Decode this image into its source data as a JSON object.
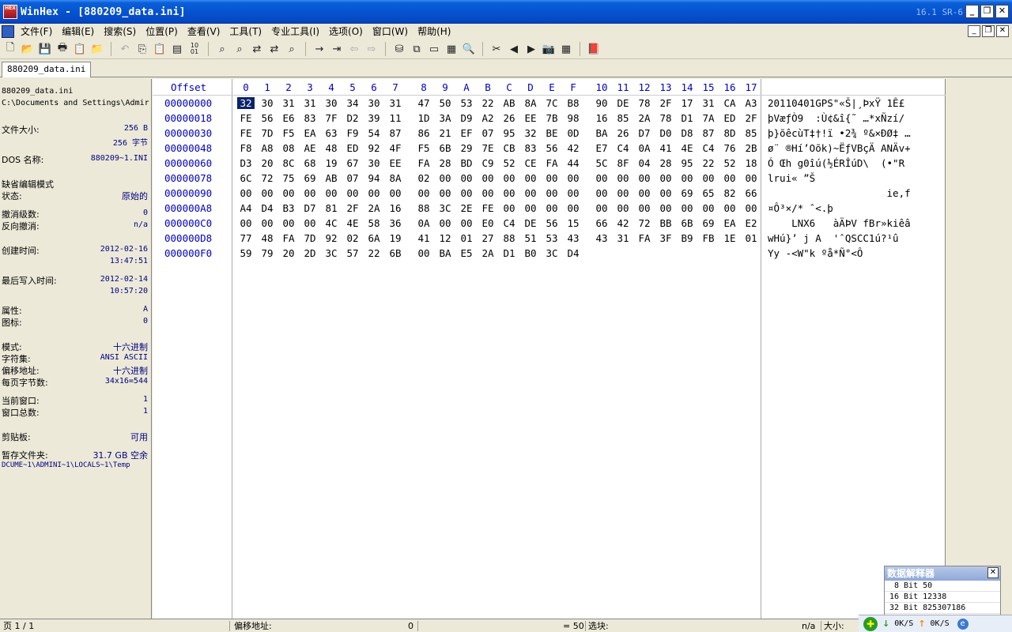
{
  "window": {
    "title": "WinHex - [880209_data.ini]",
    "version": "16.1 SR-6",
    "app_icon": "HEX",
    "controls": [
      "_",
      "❐",
      "✕"
    ]
  },
  "menu": {
    "items": [
      "文件(F)",
      "编辑(E)",
      "搜索(S)",
      "位置(P)",
      "查看(V)",
      "工具(T)",
      "专业工具(I)",
      "选项(O)",
      "窗口(W)",
      "帮助(H)"
    ]
  },
  "toolbar": {
    "icons": [
      "new-file-icon",
      "open-icon",
      "save-icon",
      "print-icon",
      "properties-icon",
      "open-disk-icon",
      "undo-icon",
      "copy-icon",
      "paste-icon",
      "paste-special-icon",
      "binary-icon",
      "find-text-icon",
      "find-hex-icon",
      "replace-text-icon",
      "replace-hex-icon",
      "find-next-icon",
      "goto-offset-icon",
      "goto-icon",
      "back-icon",
      "forward-icon",
      "disk-icon",
      "clone-icon",
      "ram-icon",
      "calculator-icon",
      "search-icon",
      "cut-icon",
      "prev-icon",
      "next-icon",
      "snapshot-icon",
      "table-icon",
      "help-book-icon"
    ]
  },
  "tab": {
    "label": "880209_data.ini"
  },
  "info_panel": {
    "file_name": "880209_data.ini",
    "file_path": "C:\\Documents and Settings\\Admir",
    "file_size_label": "文件大小:",
    "file_size_b": "256 B",
    "file_size_bytes": "256 字节",
    "dos_name_label": "DOS 名称:",
    "dos_name": "880209~1.INI",
    "edit_mode_label": "缺省编辑模式",
    "status_label": "状态:",
    "status": "原始的",
    "undo_levels_label": "撤消级数:",
    "undo_levels": "0",
    "reverse_undo_label": "反向撤消:",
    "reverse_undo": "n/a",
    "created_label": "创建时间:",
    "created_date": "2012-02-16",
    "created_time": "13:47:51",
    "modified_label": "最后写入时间:",
    "modified_date": "2012-02-14",
    "modified_time": "10:57:20",
    "attr_label": "属性:",
    "attr": "A",
    "icon_label": "图标:",
    "icon": "0",
    "mode_label": "模式:",
    "mode": "十六进制",
    "charset_label": "字符集:",
    "charset": "ANSI ASCII",
    "offset_label": "偏移地址:",
    "offset": "十六进制",
    "bytes_per_page_label": "每页字节数:",
    "bytes_per_page": "34x16=544",
    "current_window_label": "当前窗口:",
    "current_window": "1",
    "total_windows_label": "窗口总数:",
    "total_windows": "1",
    "clipboard_label": "剪贴板:",
    "clipboard": "可用",
    "temp_folder_label": "暂存文件夹:",
    "temp_folder_space": "31.7 GB 空余",
    "temp_folder_path": "DCUME~1\\ADMINI~1\\LOCALS~1\\Temp"
  },
  "hex_view": {
    "offset_header": "Offset",
    "columns": [
      "0",
      "1",
      "2",
      "3",
      "4",
      "5",
      "6",
      "7",
      "8",
      "9",
      "A",
      "B",
      "C",
      "D",
      "E",
      "F",
      "10",
      "11",
      "12",
      "13",
      "14",
      "15",
      "16",
      "17"
    ],
    "rows": [
      {
        "offset": "00000000",
        "bytes": [
          "32",
          "30",
          "31",
          "31",
          "30",
          "34",
          "30",
          "31",
          "47",
          "50",
          "53",
          "22",
          "AB",
          "8A",
          "7C",
          "B8",
          "90",
          "DE",
          "78",
          "2F",
          "17",
          "31",
          "CA",
          "A3"
        ],
        "ascii": "20110401GPS\"«Š|¸ÞxŸ 1Ê£"
      },
      {
        "offset": "00000018",
        "bytes": [
          "FE",
          "56",
          "E6",
          "83",
          "7F",
          "D2",
          "39",
          "11",
          "1D",
          "3A",
          "D9",
          "A2",
          "26",
          "EE",
          "7B",
          "98",
          "16",
          "85",
          "2A",
          "78",
          "D1",
          "7A",
          "ED",
          "2F"
        ],
        "ascii": "þVæƒÒ9  :Ù¢&î{˜ …*xÑzí/"
      },
      {
        "offset": "00000030",
        "bytes": [
          "FE",
          "7D",
          "F5",
          "EA",
          "63",
          "F9",
          "54",
          "87",
          "86",
          "21",
          "EF",
          "07",
          "95",
          "32",
          "BE",
          "0D",
          "BA",
          "26",
          "D7",
          "D0",
          "D8",
          "87",
          "8D",
          "85"
        ],
        "ascii": "þ}õêcùT‡†!ï •2¾ º&×ÐØ‡ …"
      },
      {
        "offset": "00000048",
        "bytes": [
          "F8",
          "A8",
          "08",
          "AE",
          "48",
          "ED",
          "92",
          "4F",
          "F5",
          "6B",
          "29",
          "7E",
          "CB",
          "83",
          "56",
          "42",
          "E7",
          "C4",
          "0A",
          "41",
          "4E",
          "C4",
          "76",
          "2B"
        ],
        "ascii": "ø¨ ®Hí’Oõk)~ËƒVBçÄ ANÄv+"
      },
      {
        "offset": "00000060",
        "bytes": [
          "D3",
          "20",
          "8C",
          "68",
          "19",
          "67",
          "30",
          "EE",
          "FA",
          "28",
          "BD",
          "C9",
          "52",
          "CE",
          "FA",
          "44",
          "5C",
          "8F",
          "04",
          "28",
          "95",
          "22",
          "52",
          "18"
        ],
        "ascii": "Ó Œh g0îú(½ÉRÎúD\\  (•\"R "
      },
      {
        "offset": "00000078",
        "bytes": [
          "6C",
          "72",
          "75",
          "69",
          "AB",
          "07",
          "94",
          "8A",
          "02",
          "00",
          "00",
          "00",
          "00",
          "00",
          "00",
          "00",
          "00",
          "00",
          "00",
          "00",
          "00",
          "00",
          "00",
          "00"
        ],
        "ascii": "lrui« ”Š"
      },
      {
        "offset": "00000090",
        "bytes": [
          "00",
          "00",
          "00",
          "00",
          "00",
          "00",
          "00",
          "00",
          "00",
          "00",
          "00",
          "00",
          "00",
          "00",
          "00",
          "00",
          "00",
          "00",
          "00",
          "00",
          "69",
          "65",
          "82",
          "66"
        ],
        "ascii": "                    ie‚f"
      },
      {
        "offset": "000000A8",
        "bytes": [
          "A4",
          "D4",
          "B3",
          "D7",
          "81",
          "2F",
          "2A",
          "16",
          "88",
          "3C",
          "2E",
          "FE",
          "00",
          "00",
          "00",
          "00",
          "00",
          "00",
          "00",
          "00",
          "00",
          "00",
          "00",
          "00"
        ],
        "ascii": "¤Ô³×/* ˆ<.þ"
      },
      {
        "offset": "000000C0",
        "bytes": [
          "00",
          "00",
          "00",
          "00",
          "4C",
          "4E",
          "58",
          "36",
          "0A",
          "00",
          "00",
          "E0",
          "C4",
          "DE",
          "56",
          "15",
          "66",
          "42",
          "72",
          "BB",
          "6B",
          "69",
          "EA",
          "E2"
        ],
        "ascii": "    LNX6   àÄÞV fBr»kiêâ"
      },
      {
        "offset": "000000D8",
        "bytes": [
          "77",
          "48",
          "FA",
          "7D",
          "92",
          "02",
          "6A",
          "19",
          "41",
          "12",
          "01",
          "27",
          "88",
          "51",
          "53",
          "43",
          "43",
          "31",
          "FA",
          "3F",
          "B9",
          "FB",
          "1E",
          "01"
        ],
        "ascii": "wHú}’ j A  'ˆQSCC1ú?¹û"
      },
      {
        "offset": "000000F0",
        "bytes": [
          "59",
          "79",
          "20",
          "2D",
          "3C",
          "57",
          "22",
          "6B",
          "00",
          "BA",
          "E5",
          "2A",
          "D1",
          "B0",
          "3C",
          "D4"
        ],
        "ascii": "Yy -<W\"k ºå*Ñ°<Ô"
      }
    ]
  },
  "interpreter": {
    "title": "数据解释器",
    "lines": [
      "8 Bit 50",
      "16 Bit 12338",
      "32 Bit 825307186"
    ]
  },
  "statusbar": {
    "page": "页 1 / 1",
    "offset_label": "偏移地址:",
    "offset_value": "0",
    "value": "= 50",
    "block_label": "选块:",
    "block_value": "n/a",
    "size_label": "大小:",
    "size_value": "n/a"
  },
  "tray": {
    "down_speed": "0K/S",
    "up_speed": "0K/S"
  },
  "colors": {
    "title_bar": "#0553d1",
    "offset_blue": "#0000c0",
    "value_navy": "#000080",
    "selection": "#0a246a"
  }
}
